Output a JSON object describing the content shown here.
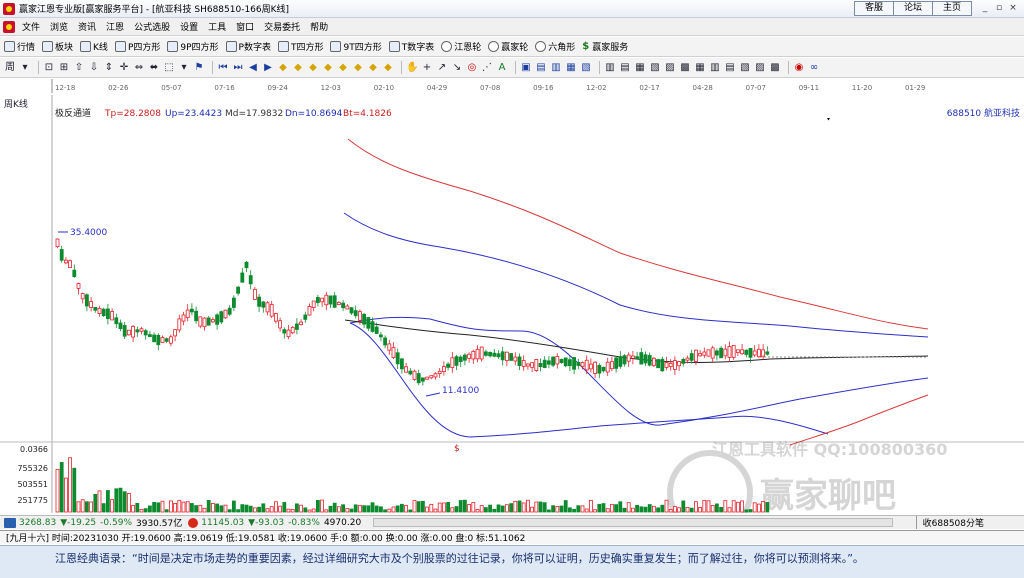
{
  "window": {
    "title": "赢家江恩专业版[赢家服务平台] - [航亚科技  SH688510-166周K线]",
    "top_buttons": [
      "客服",
      "论坛",
      "主页"
    ],
    "controls": [
      "_",
      "▫",
      "×"
    ]
  },
  "menu": [
    "文件",
    "浏览",
    "资讯",
    "江恩",
    "公式选股",
    "设置",
    "工具",
    "窗口",
    "交易委托",
    "帮助"
  ],
  "toolbar": [
    {
      "label": "行情",
      "icon": "grid-icon"
    },
    {
      "label": "板块",
      "icon": "blocks-icon"
    },
    {
      "label": "K线",
      "icon": "kline-icon"
    },
    {
      "label": "P四方形",
      "icon": "p-square-icon"
    },
    {
      "label": "9P四方形",
      "icon": "9p-square-icon"
    },
    {
      "label": "P数字表",
      "icon": "p-table-icon"
    },
    {
      "label": "T四方形",
      "icon": "t-square-icon"
    },
    {
      "label": "9T四方形",
      "icon": "9t-square-icon"
    },
    {
      "label": "T数字表",
      "icon": "t-table-icon"
    },
    {
      "label": "江恩轮",
      "icon": "wheel-icon"
    },
    {
      "label": "赢家轮",
      "icon": "winner-wheel-icon"
    },
    {
      "label": "六角形",
      "icon": "hexagon-icon"
    },
    {
      "label": "赢家服务",
      "icon": "dollar-icon"
    }
  ],
  "chart_header": {
    "period": "周K线",
    "indicator": "极反通道",
    "Tp": "Tp=28.2808",
    "Up": "Up=23.4423",
    "Md": "Md=17.9832",
    "Dn": "Dn=10.8694",
    "Bt": "Bt=4.1826",
    "stock": "688510  航亚科技"
  },
  "date_ticks": [
    "12-18",
    "02-26",
    "05-07",
    "07-16",
    "09-24",
    "12-03",
    "02-10",
    "04-29",
    "07-08",
    "09-16",
    "12-02",
    "02-17",
    "04-28",
    "07-07",
    "09-11",
    "11-20",
    "01-29"
  ],
  "chart_data": {
    "type": "candlestick",
    "annotations": {
      "high_label": "35.4000",
      "low_label": "11.4100",
      "marker": "$"
    },
    "volume_axis": [
      "0.0366",
      "755326",
      "503551",
      "251775"
    ],
    "watermark": {
      "line1": "江恩工具软件  QQ:100800360",
      "brand": "赢家聊吧",
      "url": "liaoba.yict360.com"
    },
    "colors": {
      "up": "#e4222a",
      "down": "#0e8a2f",
      "upper_band": "#d93a3a",
      "mid_band": "#2b2fc8",
      "ma": "#222222"
    }
  },
  "status": {
    "index1_value": "3268.83",
    "index1_change": "▼-19.25",
    "index1_pct": "-0.59%",
    "index1_amount": "3930.57亿",
    "index2_value": "11145.03",
    "index2_change": "▼-93.03",
    "index2_pct": "-0.83%",
    "index2_amount": "4970.20",
    "right_text": "收688508分笔"
  },
  "info": {
    "text": "[九月十六] 时间:20231030 开:19.0600 高:19.0619 低:19.0581 收:19.0600 手:0 额:0.00 换:0.00 涨:0.00 盘:0 标:51.1062"
  },
  "quote": "江恩经典语录：“时间是决定市场走势的重要因素，经过详细研究大市及个别股票的过往记录，你将可以证明，历史确实重复发生；而了解过往，你将可以预测将来。”。"
}
